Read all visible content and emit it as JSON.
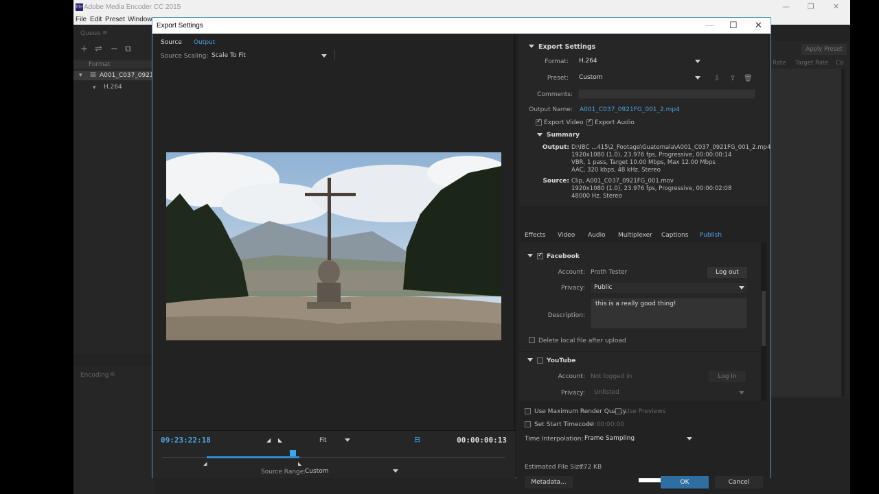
{
  "app": {
    "title": "Adobe Media Encoder CC 2015",
    "menu": [
      "File",
      "Edit",
      "Preset",
      "Window"
    ],
    "queue_label": "Queue",
    "queue_format_col": "Format",
    "queue_item_name": "A001_C037_0921",
    "queue_item_format": "H.264",
    "encoding_label": "Encoding",
    "apply_preset": "Apply Preset",
    "col_rate": "Rate",
    "col_target_rate": "Target Rate",
    "col_co": "Co"
  },
  "dialog": {
    "title": "Export Settings",
    "tabs": {
      "source": "Source",
      "output": "Output"
    },
    "source_scaling_label": "Source Scaling:",
    "source_scaling_value": "Scale To Fit",
    "timecode_current": "09:23:22:18",
    "timecode_duration": "00:00:00:13",
    "zoom_value": "Fit",
    "source_range_label": "Source Range:",
    "source_range_value": "Custom",
    "range_fraction": {
      "start": 0.13,
      "end": 0.4,
      "playhead": 0.38
    }
  },
  "export_settings": {
    "section_title": "Export Settings",
    "format_label": "Format:",
    "format_value": "H.264",
    "preset_label": "Preset:",
    "preset_value": "Custom",
    "comments_label": "Comments:",
    "output_name_label": "Output Name:",
    "output_name_value": "A001_C037_0921FG_001_2.mp4",
    "export_video_label": "Export Video",
    "export_audio_label": "Export Audio",
    "export_video_checked": true,
    "export_audio_checked": true,
    "summary_title": "Summary",
    "summary_output_label": "Output:",
    "summary_output_lines": [
      "D:\\IBC ...415\\2_Footage\\Guatemala\\A001_C037_0921FG_001_2.mp4",
      "1920x1080 (1.0), 23.976 fps, Progressive, 00:00:00:14",
      "VBR, 1 pass, Target 10.00 Mbps, Max 12.00 Mbps",
      "AAC, 320 kbps, 48 kHz, Stereo"
    ],
    "summary_source_label": "Source:",
    "summary_source_lines": [
      "Clip, A001_C037_0921FG_001.mov",
      "1920x1080 (1.0), 23.976 fps, Progressive, 00:00:02:08",
      "48000 Hz, Stereo"
    ]
  },
  "settings_tabs": [
    "Effects",
    "Video",
    "Audio",
    "Multiplexer",
    "Captions",
    "Publish"
  ],
  "publish": {
    "facebook_title": "Facebook",
    "account_label": "Account:",
    "account_value": "Proth Tester",
    "log_out": "Log out",
    "privacy_label": "Privacy:",
    "privacy_value": "Public",
    "description_label": "Description:",
    "description_value": "this is a really good thing!",
    "delete_local_label": "Delete local file after upload",
    "youtube_title": "YouTube",
    "yt_account_label": "Account:",
    "yt_account_value": "Not logged in",
    "yt_log_in": "Log In",
    "yt_privacy_label": "Privacy:",
    "yt_privacy_value": "Unlisted"
  },
  "bottom": {
    "max_render_label": "Use Maximum Render Quality",
    "use_previews_label": "Use Previews",
    "set_start_tc_label": "Set Start Timecode",
    "start_tc_value": "00:00:00:00",
    "time_interp_label": "Time Interpolation:",
    "time_interp_value": "Frame Sampling",
    "file_size_label": "Estimated File Size:",
    "file_size_value": "772 KB",
    "metadata_btn": "Metadata...",
    "ok_btn": "OK",
    "cancel_btn": "Cancel"
  }
}
